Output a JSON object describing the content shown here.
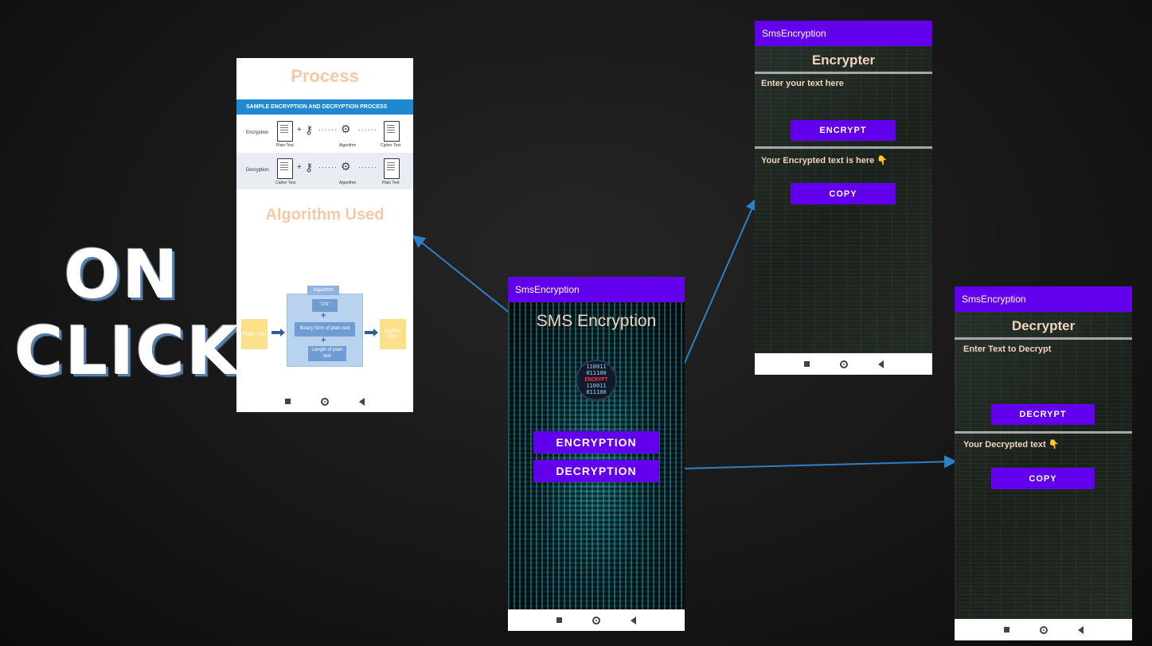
{
  "slide": {
    "headline_line1": "ON",
    "headline_line2": "CLICK"
  },
  "process_screen": {
    "title": "Process",
    "banner": "SAMPLE ENCRYPTION AND DECRYPTION PROCESS",
    "encryption_row": {
      "label": "Encryption",
      "left_doc": "Plain Text",
      "middle": "Algorithm",
      "right_doc": "Cipher Text"
    },
    "decryption_row": {
      "label": "Decryption",
      "left_doc": "Cipher Text",
      "middle": "Algorithm",
      "right_doc": "Plain Text"
    },
    "algorithm_title": "Algorithm Used",
    "diagram": {
      "left_box": "Plain Text",
      "right_box": "Cipher Text",
      "tab": "Algorithm",
      "step1": "\"101\"",
      "step2": "Binary form of plain text",
      "step3": "Length of plain text"
    }
  },
  "main_screen": {
    "appbar_title": "SmsEncryption",
    "title": "SMS Encryption",
    "logo_lines": [
      "110011",
      "011100",
      "ENCRYPT",
      "110011",
      "011100"
    ],
    "encryption_button": "ENCRYPTION",
    "decryption_button": "DECRYPTION"
  },
  "encrypter_screen": {
    "appbar_title": "SmsEncryption",
    "title": "Encrypter",
    "input_placeholder": "Enter your text here",
    "encrypt_button": "ENCRYPT",
    "output_label": "Your Encrypted text is here 👇",
    "copy_button": "COPY"
  },
  "decrypter_screen": {
    "appbar_title": "SmsEncryption",
    "title": "Decrypter",
    "input_placeholder": "Enter Text to Decrypt",
    "decrypt_button": "DECRYPT",
    "output_label": "Your Decrypted text 👇",
    "copy_button": "COPY"
  },
  "colors": {
    "appbar": "#6200ee",
    "button": "#6200ee",
    "connector": "#2f7fc4",
    "process_title": "#f4c9a6"
  }
}
